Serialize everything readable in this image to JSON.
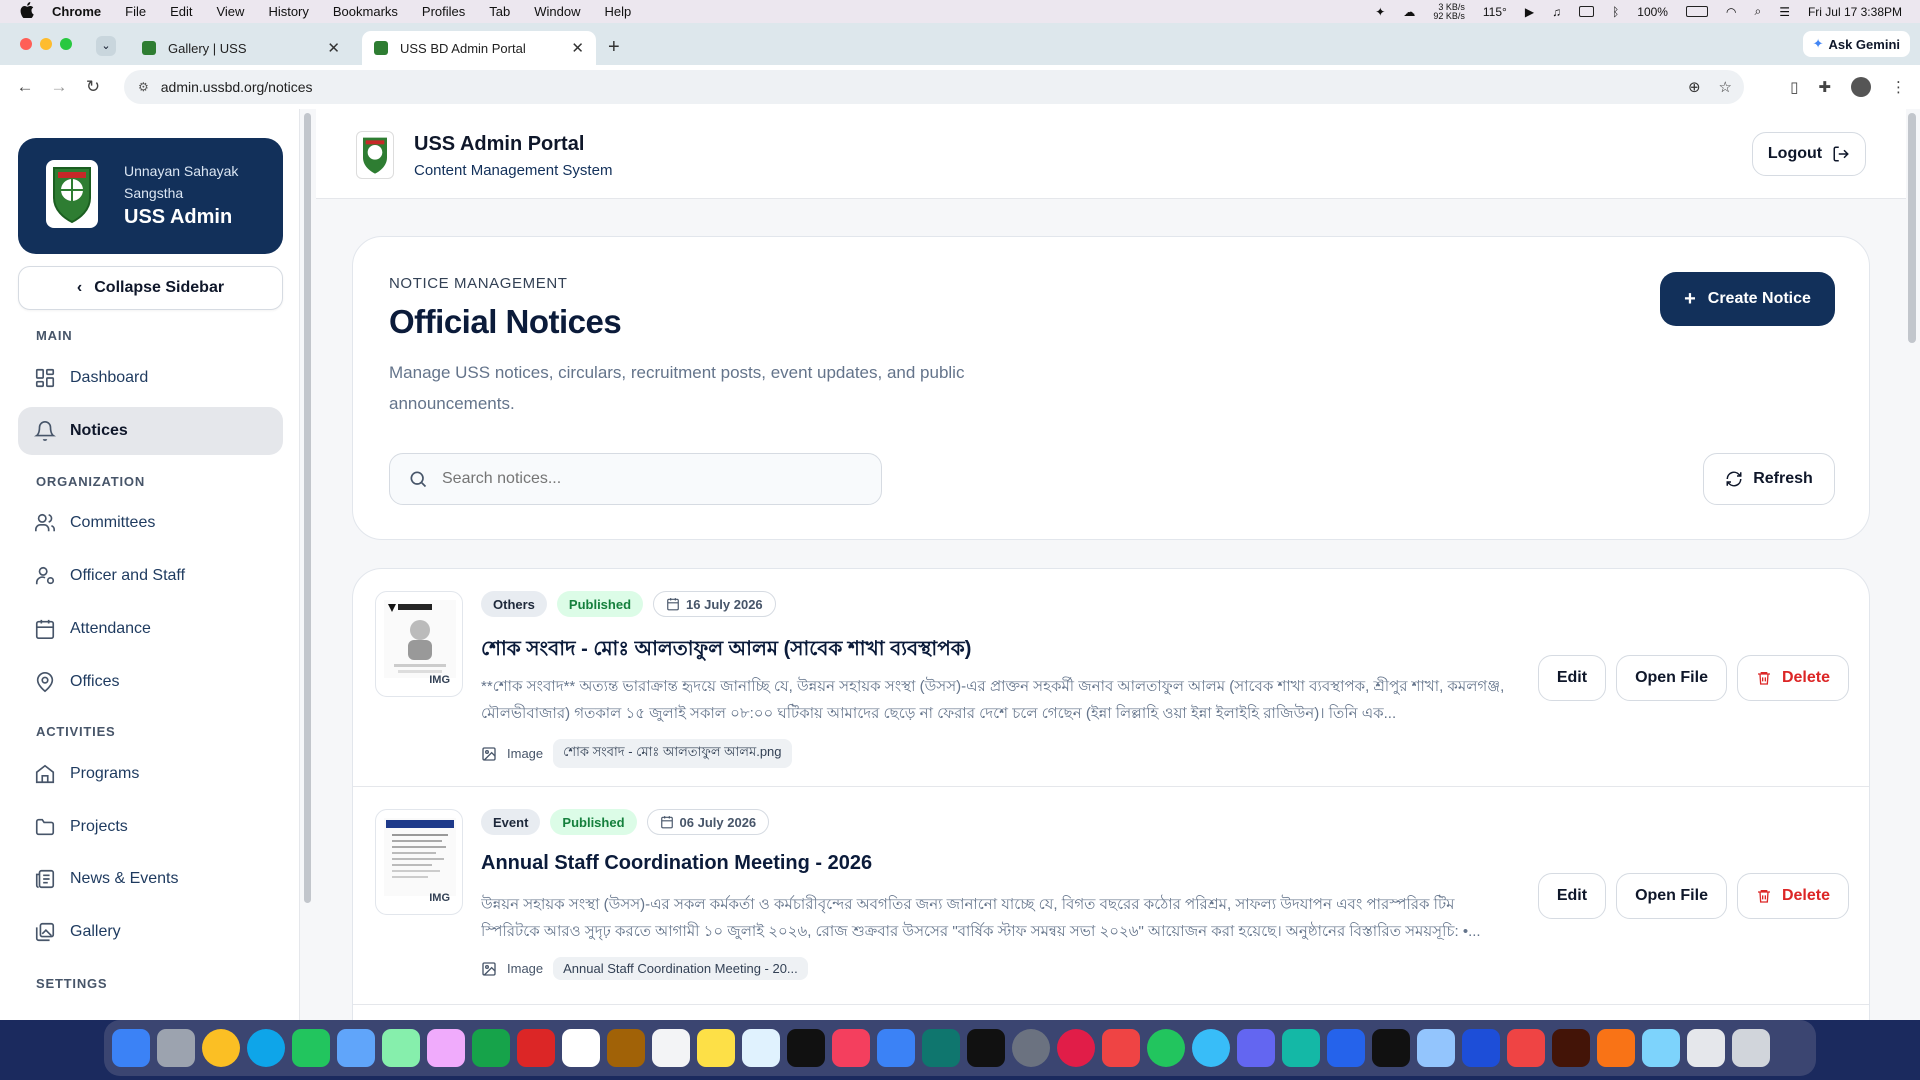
{
  "menubar": {
    "app": "Chrome",
    "items": [
      "File",
      "Edit",
      "View",
      "History",
      "Bookmarks",
      "Profiles",
      "Tab",
      "Window",
      "Help"
    ],
    "net_up": "3 KB/s",
    "net_down": "92 KB/s",
    "temp": "115°",
    "battery": "100%",
    "datetime": "Fri Jul 17  3:38PM"
  },
  "browser": {
    "tabs": [
      {
        "title": "Gallery | USS",
        "active": false
      },
      {
        "title": "USS BD Admin Portal",
        "active": true
      }
    ],
    "url": "admin.ussbd.org/notices",
    "ask_gemini": "Ask Gemini"
  },
  "sidebar": {
    "org_line": "Unnayan Sahayak Sangstha",
    "title": "USS Admin",
    "collapse_label": "Collapse Sidebar",
    "sections": {
      "main": "MAIN",
      "organization": "ORGANIZATION",
      "activities": "ACTIVITIES",
      "settings": "SETTINGS"
    },
    "items": {
      "dashboard": "Dashboard",
      "notices": "Notices",
      "committees": "Committees",
      "officer_staff": "Officer and Staff",
      "attendance": "Attendance",
      "offices": "Offices",
      "programs": "Programs",
      "projects": "Projects",
      "news_events": "News & Events",
      "gallery": "Gallery"
    }
  },
  "header": {
    "title": "USS Admin Portal",
    "subtitle": "Content Management System",
    "logout": "Logout"
  },
  "hero": {
    "kicker": "NOTICE MANAGEMENT",
    "title": "Official Notices",
    "description": "Manage USS notices, circulars, recruitment posts, event updates, and public announcements.",
    "create_label": "Create Notice",
    "search_placeholder": "Search notices...",
    "refresh_label": "Refresh"
  },
  "notices": [
    {
      "category": "Others",
      "status": "Published",
      "date": "16 July 2026",
      "title": "শোক সংবাদ - মোঃ আলতাফুল আলম (সাবেক শাখা ব্যবস্থাপক)",
      "body": "**শোক সংবাদ** অত্যন্ত ভারাক্রান্ত হৃদয়ে জানাচ্ছি যে, উন্নয়ন সহায়ক সংস্থা (উসস)-এর প্রাক্তন সহকর্মী জনাব আলতাফুল আলম (সাবেক শাখা ব্যবস্থাপক, শ্রীপুর শাখা, কমলগঞ্জ, মৌলভীবাজার) গতকাল ১৫ জুলাই সকাল ০৮:০০ ঘটিকায় আমাদের ছেড়ে না ফেরার দেশে চলে গেছেন (ইন্না লিল্লাহি ওয়া ইন্না ইলাইহি রাজিউন)। তিনি এক...",
      "attachment_type": "Image",
      "filename": "শোক সংবাদ - মোঃ আলতাফুল আলম.png",
      "thumb_tag": "IMG"
    },
    {
      "category": "Event",
      "status": "Published",
      "date": "06 July 2026",
      "title": "Annual Staff Coordination Meeting - 2026",
      "body": "উন্নয়ন সহায়ক সংস্থা (উসস)-এর সকল কর্মকর্তা ও কর্মচারীবৃন্দের অবগতির জন্য জানানো যাচ্ছে যে, বিগত বছরের কঠোর পরিশ্রম, সাফল্য উদযাপন এবং পারস্পরিক টিম স্পিরিটকে আরও সুদৃঢ় করতে আগামী ১০ জুলাই ২০২৬, রোজ শুক্রবার উসসের \"বার্ষিক স্টাফ সমন্বয় সভা ২০২৬\" আয়োজন করা হয়েছে। অনুষ্ঠানের বিস্তারিত সময়সূচি: •...",
      "attachment_type": "Image",
      "filename": "Annual Staff Coordination Meeting - 20...",
      "thumb_tag": "IMG"
    }
  ],
  "actions": {
    "edit": "Edit",
    "open_file": "Open File",
    "delete": "Delete"
  },
  "colors": {
    "brand_navy": "#12305a",
    "published_green": "#15803d",
    "delete_red": "#dc2626"
  }
}
